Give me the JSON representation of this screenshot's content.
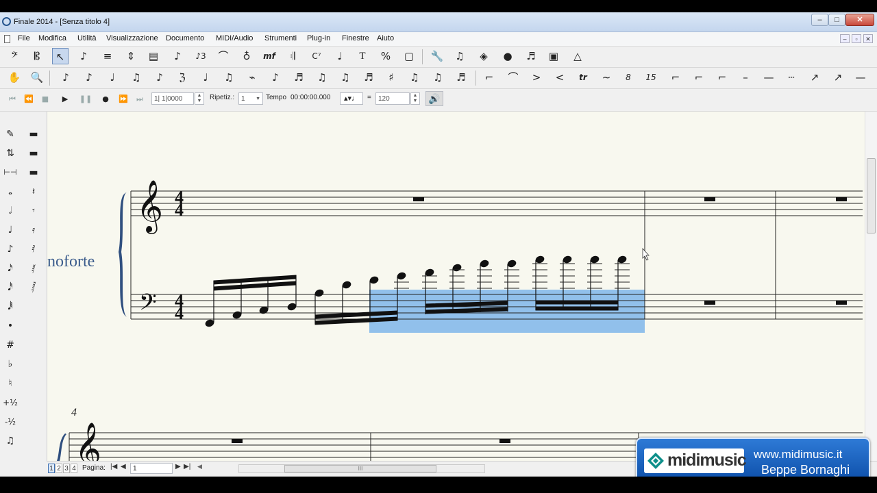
{
  "window": {
    "title": "Finale 2014 - [Senza titolo 4]",
    "buttons": {
      "minimize": "–",
      "maximize": "□",
      "close": "✕"
    }
  },
  "menu": [
    "File",
    "Modifica",
    "Utilità",
    "Visualizzazione",
    "Documento",
    "MIDI/Audio",
    "Strumenti",
    "Plug-in",
    "Finestre",
    "Aiuto"
  ],
  "mdi_buttons": [
    "–",
    "▫",
    "✕"
  ],
  "toolbar1": {
    "tools": [
      "bass-clef-tool",
      "alto-clef-tool",
      "selection-tool",
      "simple-entry-tool",
      "staff-tool",
      "resize-tool",
      "measure-tool",
      "note-tool",
      "tuplet-tool",
      "smart-shape-tool",
      "articulation-tool",
      "expression-tool",
      "repeat-tool",
      "chord-tool",
      "lyrics-tool",
      "text-tool",
      "resize-percent-tool",
      "page-layout-tool",
      "wrench-tool",
      "mirror-tool",
      "special-tools-tool",
      "hyperscribe-tool",
      "speedy-entry-tool",
      "graphics-tool",
      "metronome-tool"
    ],
    "text_glyphs": {
      "chord": "C⁷",
      "text": "T",
      "percent": "%"
    }
  },
  "toolbar2": {
    "tools": [
      "hand-grabber-tool",
      "zoom-tool",
      "sixteenth-dotted-tool",
      "eighth-note-tool",
      "stem-tool",
      "beam-tool",
      "flag-tool",
      "beam-break-tool",
      "beam-extend-tool",
      "beam-angle-tool",
      "beam-stem-tool",
      "flip-beam-tool",
      "secondary-beam-tool",
      "broken-beam-tool",
      "beam-across-tool",
      "rest-tool",
      "beam-over-barline-tool",
      "stemlet-tool",
      "slur-tool",
      "tie-tool",
      "crescendo-tool",
      "decrescendo-tool",
      "trill-tool",
      "trill-extension-tool",
      "ottava-tool",
      "quindicesima-tool",
      "bracket-tool",
      "dashed-bracket-tool",
      "line-tool",
      "dashed-line-tool",
      "solid-line-tool",
      "dotted-line-tool",
      "arrow-tool",
      "curved-arrow-tool",
      "custom-line-tool"
    ]
  },
  "playback": {
    "counter": "1| 1|0000",
    "repeat_label": "Ripetiz.:",
    "repeat_value": "1",
    "tempo_label": "Tempo",
    "tempo_time": "00:00:00.000",
    "equals": "=",
    "bpm": "120"
  },
  "palette": [
    "eraser-tool",
    "flip-tool",
    "rest-tool",
    "whole-note-tool",
    "half-note-tool",
    "quarter-note-tool",
    "eighth-note-tool",
    "sixteenth-note-tool",
    "thirty-second-note-tool",
    "sixty-fourth-note-tool",
    "augmentation-dot-tool",
    "sharp-tool",
    "flat-tool",
    "natural-tool",
    "half-step-up-tool",
    "half-step-down-tool",
    "tie-tool",
    "grace-note-tool"
  ],
  "palette_text": {
    "sharp": "#",
    "flat": "♭",
    "natural": "♮",
    "up": "+½",
    "down": "-½",
    "dot": "•"
  },
  "score": {
    "instrument_label": "noforte",
    "measure_number": "4",
    "time_signature": {
      "top": "4",
      "bottom": "4"
    }
  },
  "status": {
    "pages": [
      "1",
      "2",
      "3",
      "4"
    ],
    "page_label": "Pagina:",
    "page_value": "1",
    "scroll_grip": "III"
  },
  "banner": {
    "logo_text": "midimusic",
    "url": "www.midimusic.it",
    "author": "Beppe Bornaghi"
  }
}
